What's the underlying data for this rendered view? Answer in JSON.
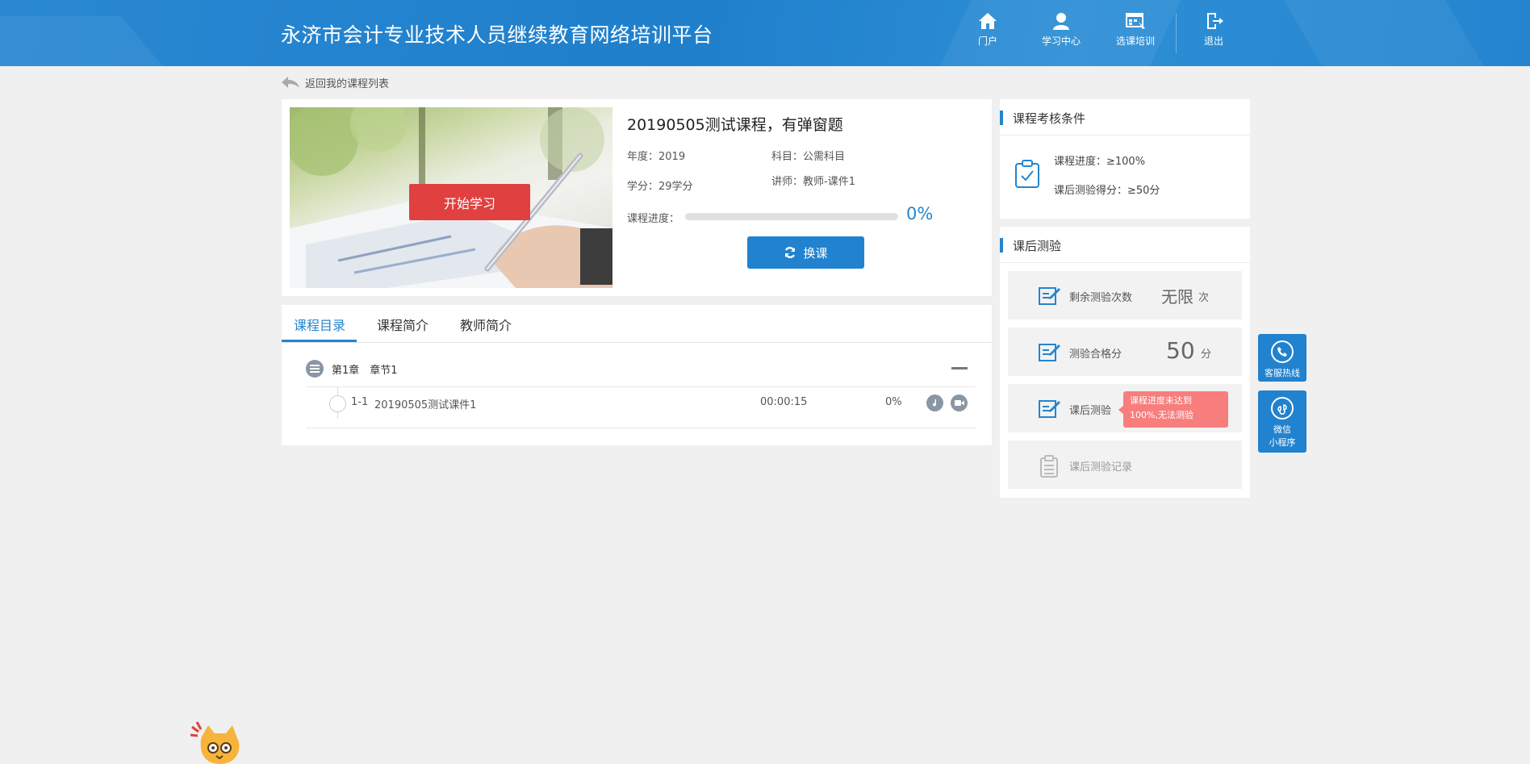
{
  "header": {
    "site_title": "永济市会计专业技术人员继续教育网络培训平台",
    "nav": [
      {
        "label": "门户",
        "icon": "home-icon"
      },
      {
        "label": "学习中心",
        "icon": "user-icon"
      },
      {
        "label": "选课培训",
        "icon": "course-select-icon"
      },
      {
        "label": "退出",
        "icon": "logout-icon"
      }
    ]
  },
  "back_link": "返回我的课程列表",
  "course": {
    "title": "20190505测试课程，有弹窗题",
    "year": "年度：2019",
    "subject": "科目：公需科目",
    "credit": "学分：29学分",
    "lecturer": "讲师：教师-课件1",
    "progress_label": "课程进度：",
    "progress_value": 0,
    "progress_text": "0%",
    "start_label": "开始学习",
    "switch_label": "换课"
  },
  "tabs": [
    {
      "label": "课程目录",
      "active": true
    },
    {
      "label": "课程简介",
      "active": false
    },
    {
      "label": "教师简介",
      "active": false
    }
  ],
  "catalog": {
    "chapter": "第1章　章节1",
    "lessons": [
      {
        "no": "1-1",
        "title": "20190505测试课件1",
        "duration": "00:00:15",
        "progress": "0%"
      }
    ]
  },
  "assessment": {
    "title": "课程考核条件",
    "progress_req": "课程进度：≥100%",
    "score_req": "课后测验得分：≥50分"
  },
  "quiz": {
    "title": "课后测验",
    "remaining_label": "剩余测验次数",
    "remaining_value": "无限",
    "remaining_unit": "次",
    "pass_label": "测验合格分",
    "pass_value": "50",
    "pass_unit": "分",
    "quiz_label": "课后测验",
    "quiz_tip_line1": "课程进度未达到",
    "quiz_tip_line2": "100%,无法测验",
    "record_label": "课后测验记录"
  },
  "float": {
    "hotline": "客服热线",
    "wechat_line1": "微信",
    "wechat_line2": "小程序"
  },
  "colors": {
    "primary": "#2585cf",
    "danger": "#e04040",
    "tip": "#f87d7d",
    "background": "#f0f0f0"
  }
}
